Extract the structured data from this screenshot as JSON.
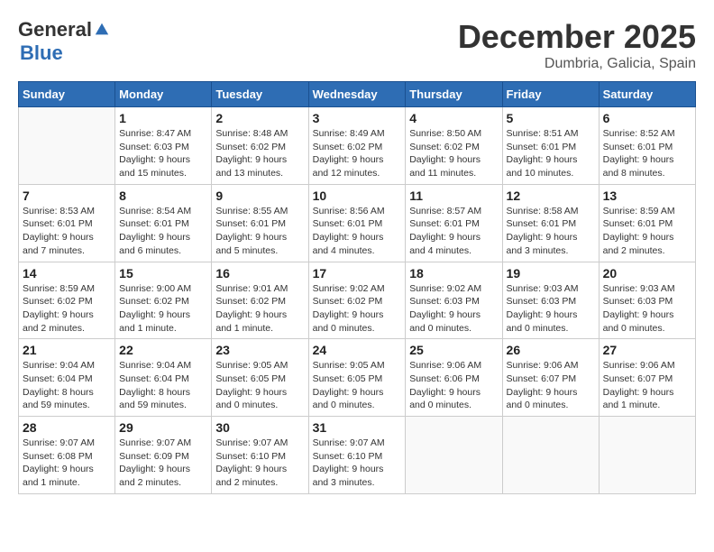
{
  "logo": {
    "general": "General",
    "blue": "Blue"
  },
  "title": "December 2025",
  "location": "Dumbria, Galicia, Spain",
  "days_of_week": [
    "Sunday",
    "Monday",
    "Tuesday",
    "Wednesday",
    "Thursday",
    "Friday",
    "Saturday"
  ],
  "weeks": [
    [
      {
        "day": "",
        "sunrise": "",
        "sunset": "",
        "daylight": ""
      },
      {
        "day": "1",
        "sunrise": "Sunrise: 8:47 AM",
        "sunset": "Sunset: 6:03 PM",
        "daylight": "Daylight: 9 hours and 15 minutes."
      },
      {
        "day": "2",
        "sunrise": "Sunrise: 8:48 AM",
        "sunset": "Sunset: 6:02 PM",
        "daylight": "Daylight: 9 hours and 13 minutes."
      },
      {
        "day": "3",
        "sunrise": "Sunrise: 8:49 AM",
        "sunset": "Sunset: 6:02 PM",
        "daylight": "Daylight: 9 hours and 12 minutes."
      },
      {
        "day": "4",
        "sunrise": "Sunrise: 8:50 AM",
        "sunset": "Sunset: 6:02 PM",
        "daylight": "Daylight: 9 hours and 11 minutes."
      },
      {
        "day": "5",
        "sunrise": "Sunrise: 8:51 AM",
        "sunset": "Sunset: 6:01 PM",
        "daylight": "Daylight: 9 hours and 10 minutes."
      },
      {
        "day": "6",
        "sunrise": "Sunrise: 8:52 AM",
        "sunset": "Sunset: 6:01 PM",
        "daylight": "Daylight: 9 hours and 8 minutes."
      }
    ],
    [
      {
        "day": "7",
        "sunrise": "Sunrise: 8:53 AM",
        "sunset": "Sunset: 6:01 PM",
        "daylight": "Daylight: 9 hours and 7 minutes."
      },
      {
        "day": "8",
        "sunrise": "Sunrise: 8:54 AM",
        "sunset": "Sunset: 6:01 PM",
        "daylight": "Daylight: 9 hours and 6 minutes."
      },
      {
        "day": "9",
        "sunrise": "Sunrise: 8:55 AM",
        "sunset": "Sunset: 6:01 PM",
        "daylight": "Daylight: 9 hours and 5 minutes."
      },
      {
        "day": "10",
        "sunrise": "Sunrise: 8:56 AM",
        "sunset": "Sunset: 6:01 PM",
        "daylight": "Daylight: 9 hours and 4 minutes."
      },
      {
        "day": "11",
        "sunrise": "Sunrise: 8:57 AM",
        "sunset": "Sunset: 6:01 PM",
        "daylight": "Daylight: 9 hours and 4 minutes."
      },
      {
        "day": "12",
        "sunrise": "Sunrise: 8:58 AM",
        "sunset": "Sunset: 6:01 PM",
        "daylight": "Daylight: 9 hours and 3 minutes."
      },
      {
        "day": "13",
        "sunrise": "Sunrise: 8:59 AM",
        "sunset": "Sunset: 6:01 PM",
        "daylight": "Daylight: 9 hours and 2 minutes."
      }
    ],
    [
      {
        "day": "14",
        "sunrise": "Sunrise: 8:59 AM",
        "sunset": "Sunset: 6:02 PM",
        "daylight": "Daylight: 9 hours and 2 minutes."
      },
      {
        "day": "15",
        "sunrise": "Sunrise: 9:00 AM",
        "sunset": "Sunset: 6:02 PM",
        "daylight": "Daylight: 9 hours and 1 minute."
      },
      {
        "day": "16",
        "sunrise": "Sunrise: 9:01 AM",
        "sunset": "Sunset: 6:02 PM",
        "daylight": "Daylight: 9 hours and 1 minute."
      },
      {
        "day": "17",
        "sunrise": "Sunrise: 9:02 AM",
        "sunset": "Sunset: 6:02 PM",
        "daylight": "Daylight: 9 hours and 0 minutes."
      },
      {
        "day": "18",
        "sunrise": "Sunrise: 9:02 AM",
        "sunset": "Sunset: 6:03 PM",
        "daylight": "Daylight: 9 hours and 0 minutes."
      },
      {
        "day": "19",
        "sunrise": "Sunrise: 9:03 AM",
        "sunset": "Sunset: 6:03 PM",
        "daylight": "Daylight: 9 hours and 0 minutes."
      },
      {
        "day": "20",
        "sunrise": "Sunrise: 9:03 AM",
        "sunset": "Sunset: 6:03 PM",
        "daylight": "Daylight: 9 hours and 0 minutes."
      }
    ],
    [
      {
        "day": "21",
        "sunrise": "Sunrise: 9:04 AM",
        "sunset": "Sunset: 6:04 PM",
        "daylight": "Daylight: 8 hours and 59 minutes."
      },
      {
        "day": "22",
        "sunrise": "Sunrise: 9:04 AM",
        "sunset": "Sunset: 6:04 PM",
        "daylight": "Daylight: 8 hours and 59 minutes."
      },
      {
        "day": "23",
        "sunrise": "Sunrise: 9:05 AM",
        "sunset": "Sunset: 6:05 PM",
        "daylight": "Daylight: 9 hours and 0 minutes."
      },
      {
        "day": "24",
        "sunrise": "Sunrise: 9:05 AM",
        "sunset": "Sunset: 6:05 PM",
        "daylight": "Daylight: 9 hours and 0 minutes."
      },
      {
        "day": "25",
        "sunrise": "Sunrise: 9:06 AM",
        "sunset": "Sunset: 6:06 PM",
        "daylight": "Daylight: 9 hours and 0 minutes."
      },
      {
        "day": "26",
        "sunrise": "Sunrise: 9:06 AM",
        "sunset": "Sunset: 6:07 PM",
        "daylight": "Daylight: 9 hours and 0 minutes."
      },
      {
        "day": "27",
        "sunrise": "Sunrise: 9:06 AM",
        "sunset": "Sunset: 6:07 PM",
        "daylight": "Daylight: 9 hours and 1 minute."
      }
    ],
    [
      {
        "day": "28",
        "sunrise": "Sunrise: 9:07 AM",
        "sunset": "Sunset: 6:08 PM",
        "daylight": "Daylight: 9 hours and 1 minute."
      },
      {
        "day": "29",
        "sunrise": "Sunrise: 9:07 AM",
        "sunset": "Sunset: 6:09 PM",
        "daylight": "Daylight: 9 hours and 2 minutes."
      },
      {
        "day": "30",
        "sunrise": "Sunrise: 9:07 AM",
        "sunset": "Sunset: 6:10 PM",
        "daylight": "Daylight: 9 hours and 2 minutes."
      },
      {
        "day": "31",
        "sunrise": "Sunrise: 9:07 AM",
        "sunset": "Sunset: 6:10 PM",
        "daylight": "Daylight: 9 hours and 3 minutes."
      },
      {
        "day": "",
        "sunrise": "",
        "sunset": "",
        "daylight": ""
      },
      {
        "day": "",
        "sunrise": "",
        "sunset": "",
        "daylight": ""
      },
      {
        "day": "",
        "sunrise": "",
        "sunset": "",
        "daylight": ""
      }
    ]
  ]
}
